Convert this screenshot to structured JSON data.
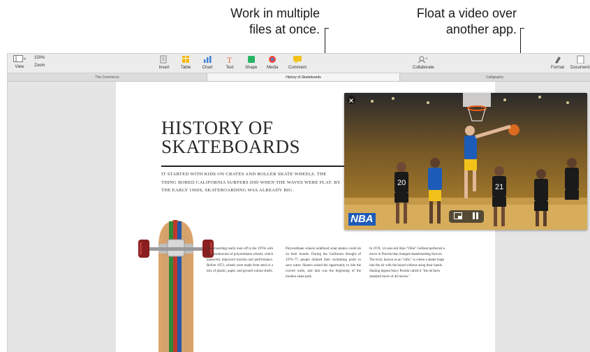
{
  "callouts": {
    "multiple_files": [
      "Work in multiple",
      "files at once."
    ],
    "float_video": [
      "Float a video over",
      "another app."
    ]
  },
  "toolbar": {
    "left": [
      {
        "label": "View",
        "icon": "sidebar-icon"
      },
      {
        "label": "Zoom",
        "value": "150%",
        "icon": "zoom-icon"
      }
    ],
    "center": [
      {
        "label": "Insert",
        "icon": "insert-icon",
        "color": "#9a9a9a"
      },
      {
        "label": "Table",
        "icon": "table-icon",
        "color": "#f2b705"
      },
      {
        "label": "Chart",
        "icon": "chart-icon",
        "color": "#3b82d6"
      },
      {
        "label": "Text",
        "icon": "text-icon",
        "color": "#e56a3c"
      },
      {
        "label": "Shape",
        "icon": "shape-icon",
        "color": "#28b463"
      },
      {
        "label": "Media",
        "icon": "media-icon",
        "color": "#e84a3c"
      },
      {
        "label": "Comment",
        "icon": "comment-icon",
        "color": "#f2c21b"
      }
    ],
    "collaborate": {
      "label": "Collaborate",
      "icon": "collaborate-icon"
    },
    "right": [
      {
        "label": "Format",
        "icon": "format-icon"
      },
      {
        "label": "Document",
        "icon": "document-icon"
      }
    ]
  },
  "tabs": [
    {
      "label": "The Commerce",
      "active": false
    },
    {
      "label": "History of Skateboards",
      "active": true
    },
    {
      "label": "Calligraphy",
      "active": false
    }
  ],
  "document": {
    "title_line1": "HISTORY OF",
    "title_line2": "SKATEBOARDS",
    "intro": "IT STARTED WITH KIDS ON CRATES AND ROLLER SKATE WHEELS. THE THING BORED CALIFORNIA SURFERS DID WHEN THE WAVES WERE FLAT. BY THE EARLY 1960S, SKATEBOARDING WAS ALREADY BIG.",
    "columns": [
      "Skateboarding really took off in the 1970s with the introduction of polyurethane wheels, which massively improved traction and performance. Before 1972, wheels were made from steel or a mix of plastic, paper, and ground walnut shells.",
      "Polyurethane wheels redefined what skaters could do on their boards. During the California drought of 1976–77, people drained their swimming pools to save water. Skaters seized the opportunity to ride the curved walls, and that was the beginning of the modern skate park.",
      "In 1978, 14-year-old Alan \"Ollie\" Gelfand perfected a move in Florida that changed skateboarding forever. The trick, known as an \"ollie,\" is where a skater leaps into the air with the board without using their hands. Skating legend Stacy Peralta called it \"the de facto standard move of all moves.\""
    ]
  },
  "video": {
    "logo": "NBA",
    "jerseys": [
      "20",
      "21"
    ],
    "controls": [
      "close-icon",
      "pip-icon",
      "pause-icon"
    ]
  },
  "colors": {
    "warriors_blue": "#1d5bb8",
    "spurs_black": "#1a1a1a",
    "board_wood": "#d9a36a"
  }
}
